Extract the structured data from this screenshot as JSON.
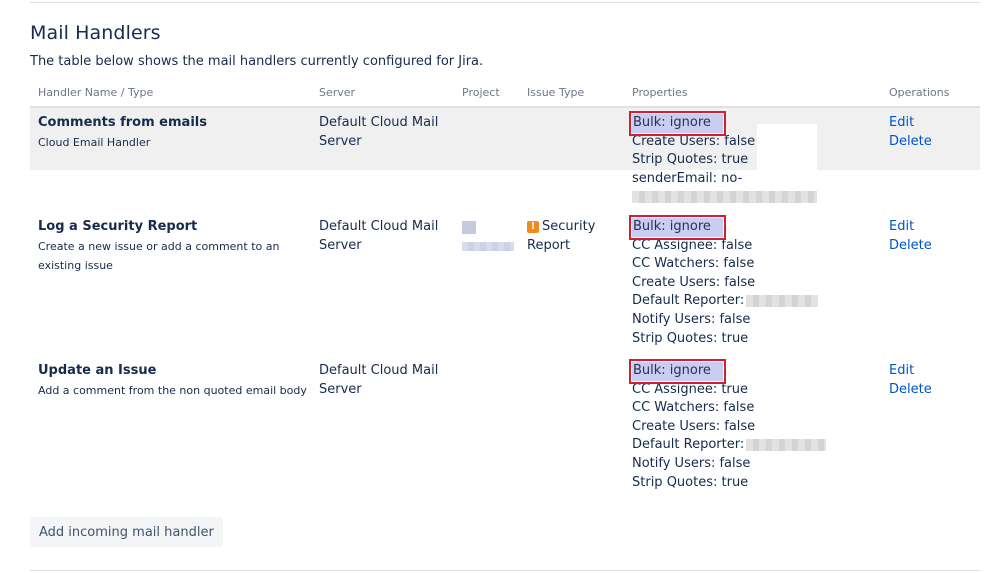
{
  "page": {
    "title": "Mail Handlers",
    "description": "The table below shows the mail handlers currently configured for Jira."
  },
  "table": {
    "headers": [
      "Handler Name / Type",
      "Server",
      "Project",
      "Issue Type",
      "Properties",
      "Operations"
    ],
    "rows": [
      {
        "name": "Comments from emails",
        "type": "Cloud Email Handler",
        "server": "Default Cloud Mail Server",
        "issue_type": "",
        "properties": [
          "Bulk: ignore",
          "Create Users: false",
          "Strip Quotes: true",
          "senderEmail: no-"
        ],
        "edit": "Edit",
        "delete": "Delete"
      },
      {
        "name": "Log a Security Report",
        "type": "Create a new issue or add a comment to an existing issue",
        "server": "Default Cloud Mail Server",
        "issue_type": "Security Report",
        "properties": [
          "Bulk: ignore",
          "CC Assignee: false",
          "CC Watchers: false",
          "Create Users: false",
          "Default Reporter:",
          "Notify Users: false",
          "Strip Quotes: true"
        ],
        "edit": "Edit",
        "delete": "Delete"
      },
      {
        "name": "Update an Issue",
        "type": "Add a comment from the non quoted email body",
        "server": "Default Cloud Mail Server",
        "issue_type": "",
        "properties": [
          "Bulk: ignore",
          "CC Assignee: true",
          "CC Watchers: false",
          "Create Users: false",
          "Default Reporter:",
          "Notify Users: false",
          "Strip Quotes: true"
        ],
        "edit": "Edit",
        "delete": "Delete"
      }
    ]
  },
  "actions": {
    "add_handler": "Add incoming mail handler"
  },
  "icons": {
    "issue_type": "warning-icon"
  },
  "colors": {
    "link": "#0052cc",
    "highlight_border": "#d21f2b",
    "row_highlight": "#f0f0f0"
  }
}
